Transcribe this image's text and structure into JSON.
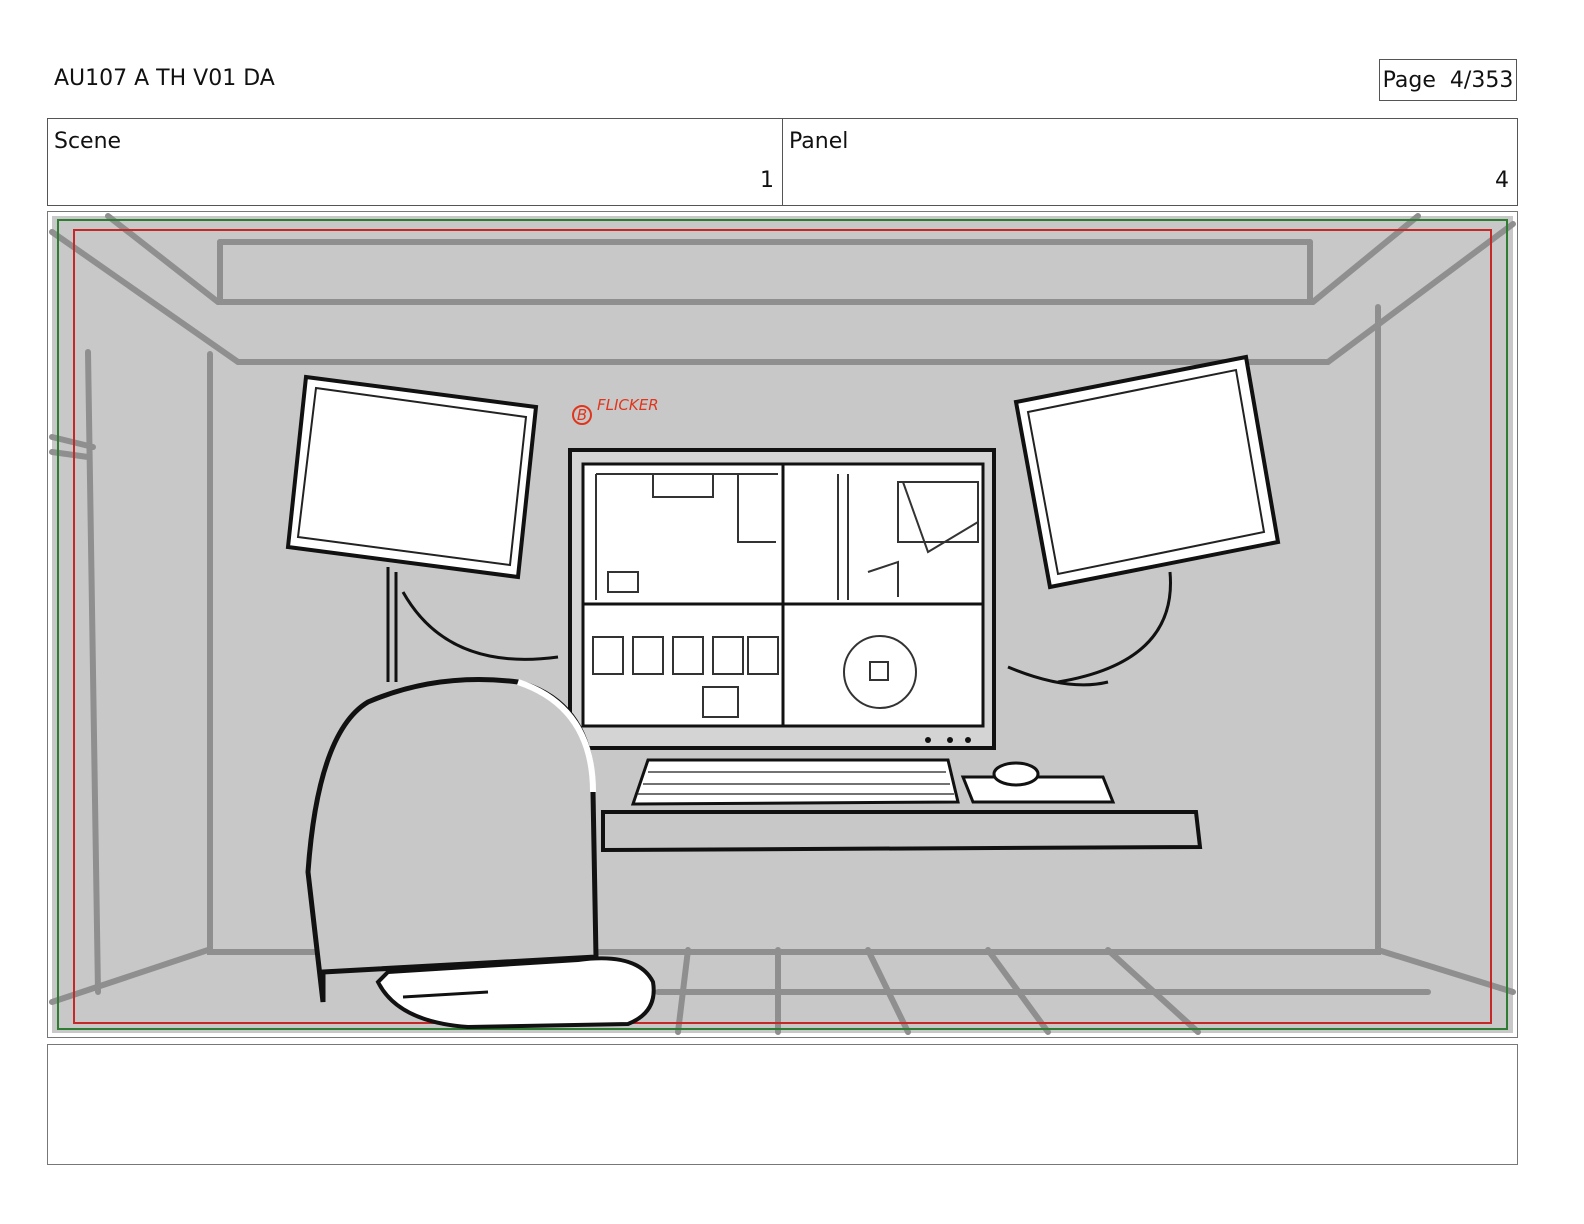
{
  "header": {
    "title": "AU107 A TH V01 DA",
    "page_label": "Page",
    "page_value": "4/353"
  },
  "info": {
    "scene_label": "Scene",
    "scene_value": "1",
    "panel_label": "Panel",
    "panel_value": "4"
  },
  "panel": {
    "annotation_marker": "B",
    "annotation_text": "FLICKER",
    "colors": {
      "background": "#c8c8c8",
      "safe_frame_outer": "#2e7d32",
      "safe_frame_inner": "#c62828",
      "annotation": "#e0351c"
    }
  },
  "caption": {
    "text": ""
  }
}
